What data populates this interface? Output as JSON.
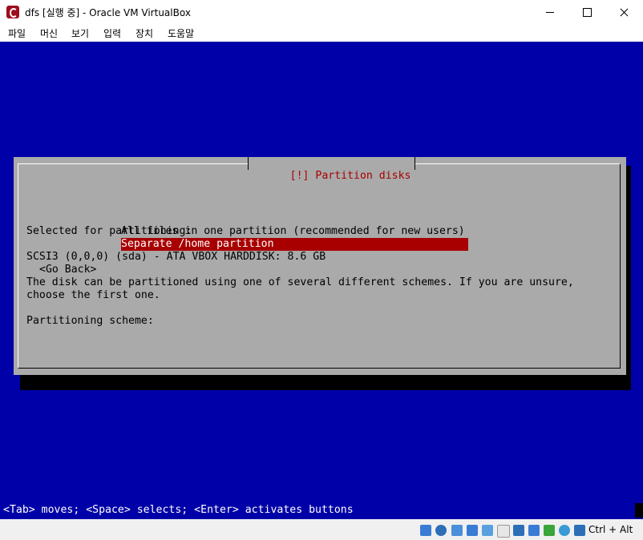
{
  "window": {
    "title": "dfs [실행 중] - Oracle VM VirtualBox"
  },
  "menu": [
    "파일",
    "머신",
    "보기",
    "입력",
    "장치",
    "도움말"
  ],
  "dialog": {
    "title": "[!] Partition disks",
    "selected_label": "Selected for partitioning:",
    "disk": "SCSI3 (0,0,0) (sda) - ATA VBOX HARDDISK: 8.6 GB",
    "description_line1": "The disk can be partitioned using one of several different schemes. If you are unsure,",
    "description_line2": "choose the first one.",
    "scheme_label": "Partitioning scheme:",
    "choices": [
      "All files in one partition (recommended for new users)",
      "Separate /home partition"
    ],
    "selected_choice": "Separate /home partition",
    "go_back": "<Go Back>"
  },
  "hint": "<Tab> moves; <Space> selects; <Enter> activates buttons",
  "statusbar": {
    "icons": [
      "hard-disk-icon",
      "optical-drive-icon",
      "audio-icon",
      "network-icon",
      "usb-icon",
      "shared-folders-icon",
      "display-icon",
      "video-capture-icon",
      "recording-icon",
      "cpu-icon",
      "mouse-integration-icon",
      "keyboard-icon"
    ],
    "host_key": "Ctrl + Alt"
  },
  "colors": {
    "screen_background": "#0000a8",
    "dialog_background": "#aaaaaa",
    "highlight": "#a80000",
    "app_icon": "#9d0e1c"
  }
}
